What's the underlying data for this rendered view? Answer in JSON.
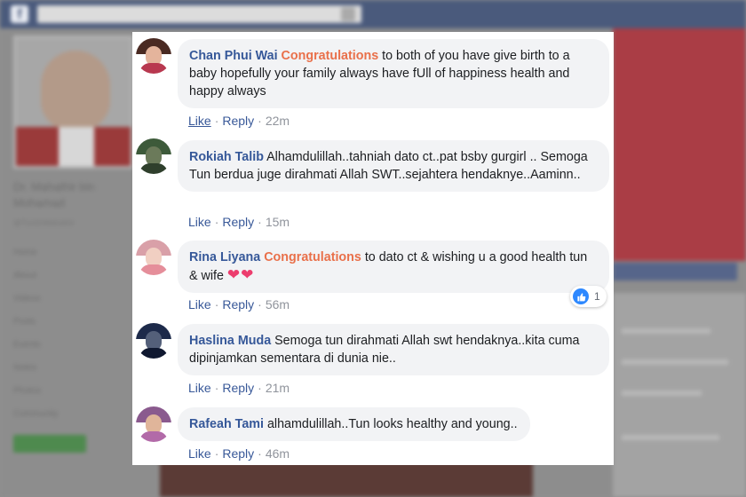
{
  "background": {
    "logo": "f",
    "profile_name": "Dr. Mahathir bin Mohamad",
    "profile_handle": "@TunDrMahathir",
    "nav_items": [
      "Home",
      "About",
      "Videos",
      "Posts",
      "Events",
      "Notes",
      "Photos",
      "Community"
    ]
  },
  "comments": [
    {
      "author": "Chan Phui Wai",
      "highlight": "Congratulations",
      "text": "to both of you have give birth to a baby hopefully your family always have fUll of happiness health and happy always",
      "like_label": "Like",
      "reply_label": "Reply",
      "time": "22m",
      "avatar_colors": {
        "hair": "#4a2a22",
        "face": "#e4b49c",
        "body": "#b8384f"
      }
    },
    {
      "author": "Rokiah Talib",
      "text": "Alhamdulillah..tahniah dato ct..pat bsby gurgirl .. Semoga Tun berdua juge dirahmati Allah SWT..sejahtera hendaknye..Aaminn..",
      "like_label": "Like",
      "reply_label": "Reply",
      "time": "15m",
      "avatar_colors": {
        "hair": "#3d5a3a",
        "face": "#6b7a5a",
        "body": "#2f3f2c"
      }
    },
    {
      "author": "Rina Liyana",
      "highlight": "Congratulations",
      "text": "to dato ct & wishing u a good health tun & wife",
      "hearts": "❤❤",
      "like_label": "Like",
      "reply_label": "Reply",
      "time": "56m",
      "reaction_count": "1",
      "avatar_colors": {
        "hair": "#d9a0a8",
        "face": "#f1cfc2",
        "body": "#e58e9a"
      }
    },
    {
      "author": "Haslina Muda",
      "text": "Semoga tun dirahmati Allah swt hendaknya..kita cuma dipinjamkan sementara di dunia nie..",
      "like_label": "Like",
      "reply_label": "Reply",
      "time": "21m",
      "avatar_colors": {
        "hair": "#1d2a4a",
        "face": "#54607a",
        "body": "#0f1830"
      }
    },
    {
      "author": "Rafeah Tami",
      "text": "alhamdulillah..Tun looks healthy and young..",
      "like_label": "Like",
      "reply_label": "Reply",
      "time": "46m",
      "avatar_colors": {
        "hair": "#8a5a8e",
        "face": "#e0b59a",
        "body": "#b26aa8"
      }
    }
  ],
  "colors": {
    "author": "#365899",
    "highlight": "#e9704a",
    "bubble": "#f2f3f5",
    "link": "#385898",
    "muted": "#90949c"
  },
  "icons": {
    "reaction": "thumbs-up-icon",
    "hearts": "heart-icon"
  }
}
